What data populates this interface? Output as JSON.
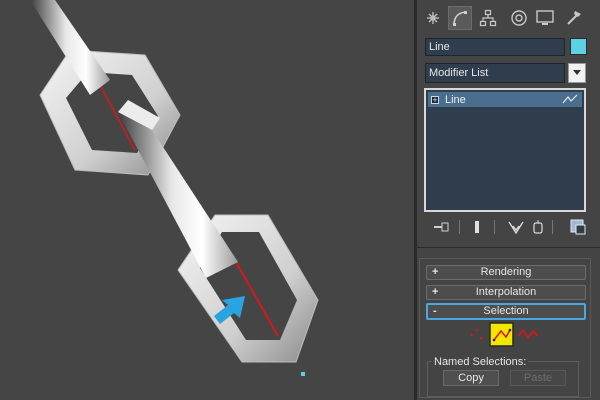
{
  "command_panel": {
    "tabs": [
      "create-icon",
      "modify-icon",
      "hierarchy-icon",
      "motion-icon",
      "display-icon",
      "utilities-icon"
    ],
    "active_tab": "modify-icon",
    "object_name": "Line",
    "object_color": "#5ed0e6",
    "modifier_list": "Modifier List",
    "stack": {
      "items": [
        {
          "label": "Line",
          "expand": "+"
        }
      ]
    },
    "stack_tools": [
      "pin-stack-icon",
      "show-end-result-icon",
      "make-unique-icon",
      "remove-modifier-icon",
      "configure-sets-icon"
    ],
    "rollouts": [
      {
        "sign": "+",
        "label": "Rendering"
      },
      {
        "sign": "+",
        "label": "Interpolation"
      },
      {
        "sign": "-",
        "label": "Selection"
      }
    ],
    "selection_levels": [
      "vertex-icon",
      "segment-icon",
      "spline-icon"
    ],
    "active_selection_level": "segment-icon",
    "named_selections": {
      "label": "Named Selections:",
      "copy": "Copy",
      "paste": "Paste"
    }
  },
  "colors": {
    "accent": "#4aa7e0",
    "highlight_yellow": "#f2e600",
    "selected_segment": "#d81818",
    "arrow": "#2aa3e2"
  },
  "viewport": {
    "annotation": "arrow-pointing-to-selected-segment"
  }
}
